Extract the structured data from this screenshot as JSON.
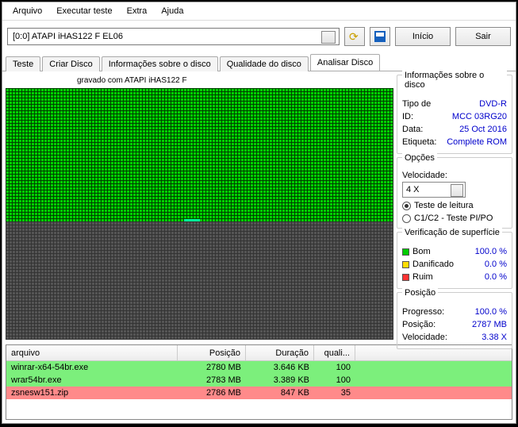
{
  "menu": {
    "arquivo": "Arquivo",
    "executar": "Executar teste",
    "extra": "Extra",
    "ajuda": "Ajuda"
  },
  "toolbar": {
    "device": "[0:0]  ATAPI iHAS122  F EL06",
    "inicio": "Início",
    "sair": "Sair"
  },
  "tabs": {
    "teste": "Teste",
    "criar": "Criar Disco",
    "info": "Informações sobre o disco",
    "qualidade": "Qualidade do disco",
    "analisar": "Analisar Disco"
  },
  "graph_title": "gravado com ATAPI   iHAS122  F",
  "info_group": {
    "title": "Informações sobre o disco",
    "tipo_l": "Tipo de",
    "tipo_v": "DVD-R",
    "id_l": "ID:",
    "id_v": "MCC 03RG20",
    "data_l": "Data:",
    "data_v": "25 Oct 2016",
    "etiqueta_l": "Etiqueta:",
    "etiqueta_v": "Complete ROM"
  },
  "opcoes": {
    "title": "Opções",
    "vel_l": "Velocidade:",
    "speed": "4 X",
    "teste_leitura": "Teste de leitura",
    "c1c2": "C1/C2 - Teste PI/PO"
  },
  "verif": {
    "title": "Verificação de superfície",
    "bom_l": "Bom",
    "bom_v": "100.0 %",
    "dan_l": "Danificado",
    "dan_v": "0.0 %",
    "ruim_l": "Ruim",
    "ruim_v": "0.0 %"
  },
  "pos": {
    "title": "Posição",
    "prog_l": "Progresso:",
    "prog_v": "100.0 %",
    "pos_l": "Posição:",
    "pos_v": "2787 MB",
    "vel_l": "Velocidade:",
    "vel_v": "3.38 X"
  },
  "files": {
    "h_arquivo": "arquivo",
    "h_pos": "Posição",
    "h_dur": "Duração",
    "h_quali": "quali...",
    "rows": [
      {
        "name": "winrar-x64-54br.exe",
        "pos": "2780 MB",
        "dur": "3.646 KB",
        "q": "100",
        "cls": "green"
      },
      {
        "name": "wrar54br.exe",
        "pos": "2783 MB",
        "dur": "3.389 KB",
        "q": "100",
        "cls": "green"
      },
      {
        "name": "zsnesw151.zip",
        "pos": "2786 MB",
        "dur": "847 KB",
        "q": "35",
        "cls": "red"
      }
    ]
  },
  "chart_data": {
    "type": "heatmap",
    "title": "Surface scan — gravado com ATAPI iHAS122 F",
    "scanned_fraction": 0.53,
    "legend": {
      "Bom": "100.0 %",
      "Danificado": "0.0 %",
      "Ruim": "0.0 %"
    },
    "colors": {
      "good": "#00cc00",
      "damaged": "#ffdd00",
      "bad": "#ff3333",
      "unscanned": "#555555"
    }
  }
}
